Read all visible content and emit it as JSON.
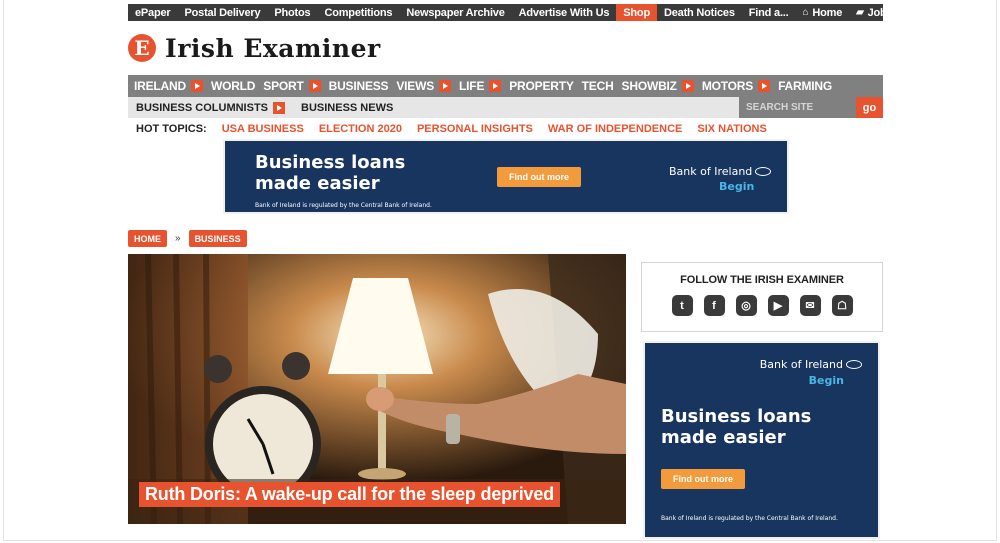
{
  "topbar": {
    "left": [
      "ePaper",
      "Postal Delivery",
      "Photos",
      "Competitions",
      "Newspaper Archive",
      "Advertise With Us",
      "Shop",
      "Death Notices"
    ],
    "right": {
      "find": "Find a...",
      "home": "Home",
      "job": "Job"
    }
  },
  "logo": {
    "badge": "E",
    "name": "Irish Examiner"
  },
  "mainnav": [
    {
      "label": "IRELAND",
      "arrow": true
    },
    {
      "label": "WORLD",
      "arrow": false
    },
    {
      "label": "SPORT",
      "arrow": true
    },
    {
      "label": "BUSINESS",
      "arrow": false
    },
    {
      "label": "VIEWS",
      "arrow": true
    },
    {
      "label": "LIFE",
      "arrow": true
    },
    {
      "label": "PROPERTY",
      "arrow": false
    },
    {
      "label": "TECH",
      "arrow": false
    },
    {
      "label": "SHOWBIZ",
      "arrow": true
    },
    {
      "label": "MOTORS",
      "arrow": true
    },
    {
      "label": "FARMING",
      "arrow": false
    }
  ],
  "subnav": {
    "items": [
      {
        "label": "BUSINESS COLUMNISTS",
        "arrow": true
      },
      {
        "label": "BUSINESS NEWS",
        "arrow": false
      }
    ],
    "search_placeholder": "SEARCH SITE",
    "search_button": "go"
  },
  "hot_topics": {
    "label": "HOT TOPICS:",
    "items": [
      "USA BUSINESS",
      "ELECTION 2020",
      "PERSONAL INSIGHTS",
      "WAR OF INDEPENDENCE",
      "SIX NATIONS"
    ]
  },
  "ad": {
    "headline_1": "Business loans",
    "headline_2": "made easier",
    "cta": "Find out more",
    "brand": "Bank of Ireland",
    "tagline": "Begin",
    "disclaimer": "Bank of Ireland is regulated by the Central Bank of Ireland."
  },
  "breadcrumb": {
    "home": "HOME",
    "separator": "»",
    "section": "BUSINESS"
  },
  "article": {
    "headline": "Ruth Doris: A wake-up call for the sleep deprived"
  },
  "follow": {
    "title": "FOLLOW THE IRISH EXAMINER",
    "icons": [
      "twitter-icon",
      "facebook-icon",
      "instagram-icon",
      "youtube-icon",
      "email-icon",
      "snapchat-icon"
    ]
  },
  "colors": {
    "accent": "#e8532f",
    "nav": "#808080",
    "ad_bg": "#17355e",
    "ad_cta": "#f39b3a"
  }
}
